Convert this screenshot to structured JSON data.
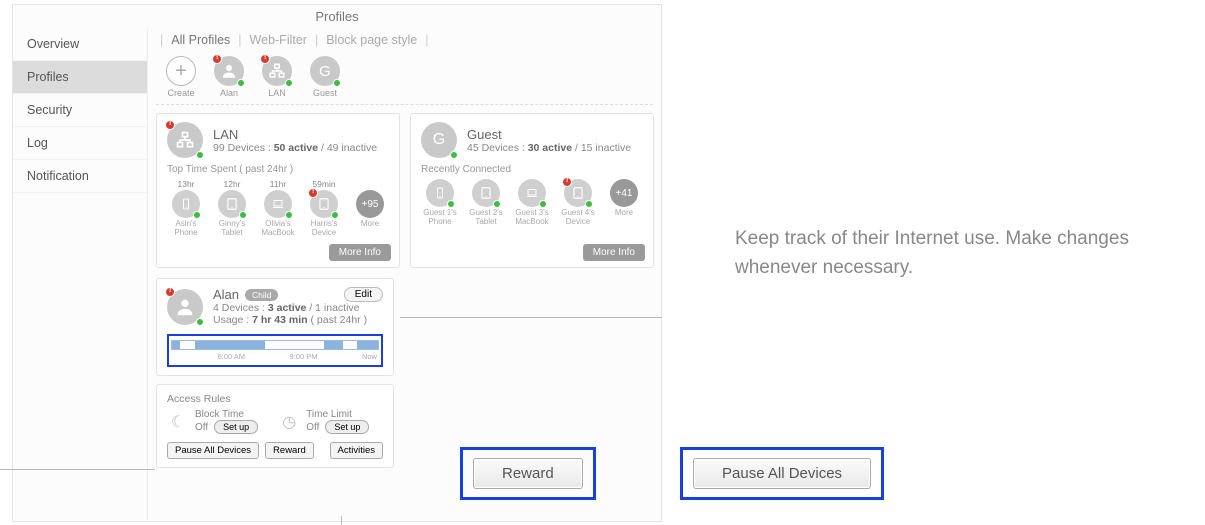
{
  "title": "Profiles",
  "sidebar": {
    "items": [
      "Overview",
      "Profiles",
      "Security",
      "Log",
      "Notification"
    ],
    "active": 1
  },
  "tabs": {
    "items": [
      "All Profiles",
      "Web-Filter",
      "Block page style"
    ],
    "active": 0
  },
  "chips": [
    {
      "label": "Create",
      "kind": "plus"
    },
    {
      "label": "Alan",
      "kind": "person",
      "alert": true
    },
    {
      "label": "LAN",
      "kind": "lan",
      "alert": true
    },
    {
      "label": "Guest",
      "kind": "letter",
      "letter": "G"
    }
  ],
  "lan": {
    "name": "LAN",
    "stat_prefix": "99 Devices : ",
    "stat_bold": "50 active",
    "stat_suffix": " / 49 inactive",
    "sub": "Top Time Spent ( past 24hr )",
    "devices": [
      {
        "time": "13hr",
        "name": "Asin's Phone",
        "icon": "phone"
      },
      {
        "time": "12hr",
        "name": "Ginny's Tablet",
        "icon": "tablet"
      },
      {
        "time": "11hr",
        "name": "Olivia's MacBook",
        "icon": "laptop"
      },
      {
        "time": "59min",
        "name": "Harris's Device",
        "icon": "tablet",
        "alert": true
      }
    ],
    "more": "+95",
    "more_label": "More",
    "more_info": "More Info"
  },
  "guest": {
    "name": "Guest",
    "letter": "G",
    "stat_prefix": "45 Devices : ",
    "stat_bold": "30 active",
    "stat_suffix": " / 15 inactive",
    "sub": "Recently Connected",
    "devices": [
      {
        "name": "Guest 1's Phone",
        "icon": "phone"
      },
      {
        "name": "Guest 2's Tablet",
        "icon": "tablet"
      },
      {
        "name": "Guest 3's MacBook",
        "icon": "laptop"
      },
      {
        "name": "Guest 4's Device",
        "icon": "tablet",
        "alert": true
      }
    ],
    "more": "+41",
    "more_label": "More",
    "more_info": "More Info"
  },
  "alan": {
    "name": "Alan",
    "badge": "Child",
    "edit": "Edit",
    "stat_prefix": "4 Devices : ",
    "stat_bold": "3 active",
    "stat_suffix": " / 1 inactive",
    "usage_label": "Usage : ",
    "usage_bold": "7 hr 43 min",
    "usage_suffix": " ( past 24hr )",
    "timeline": {
      "labels": [
        "",
        "6:00 AM",
        "9:00 PM",
        "Now"
      ],
      "segments": [
        [
          0,
          4
        ],
        [
          11,
          45
        ],
        [
          74,
          83
        ],
        [
          90,
          100
        ]
      ]
    }
  },
  "rules": {
    "title": "Access Rules",
    "block": {
      "label": "Block Time",
      "state": "Off",
      "btn": "Set up"
    },
    "limit": {
      "label": "Time Limit",
      "state": "Off",
      "btn": "Set up"
    },
    "pause": "Pause All Devices",
    "reward": "Reward",
    "activities": "Activities"
  },
  "callout": "Keep track of their Internet use. Make changes whenever necessary.",
  "big": {
    "reward": "Reward",
    "pause": "Pause All Devices"
  }
}
